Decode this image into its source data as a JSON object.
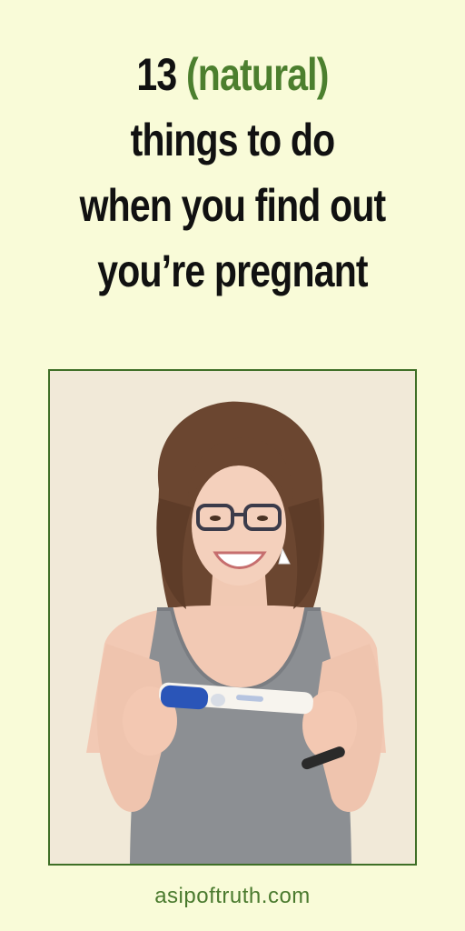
{
  "title": {
    "number": "13",
    "accent": "(natural)",
    "line2": "things to do",
    "line3": "when you find out",
    "line4": "you’re pregnant"
  },
  "colors": {
    "background": "#f9fbd8",
    "accent": "#4c7f2e",
    "frame": "#3f6f27",
    "footer": "#4a7a2e"
  },
  "footer": {
    "site": "asipoftruth.com"
  }
}
